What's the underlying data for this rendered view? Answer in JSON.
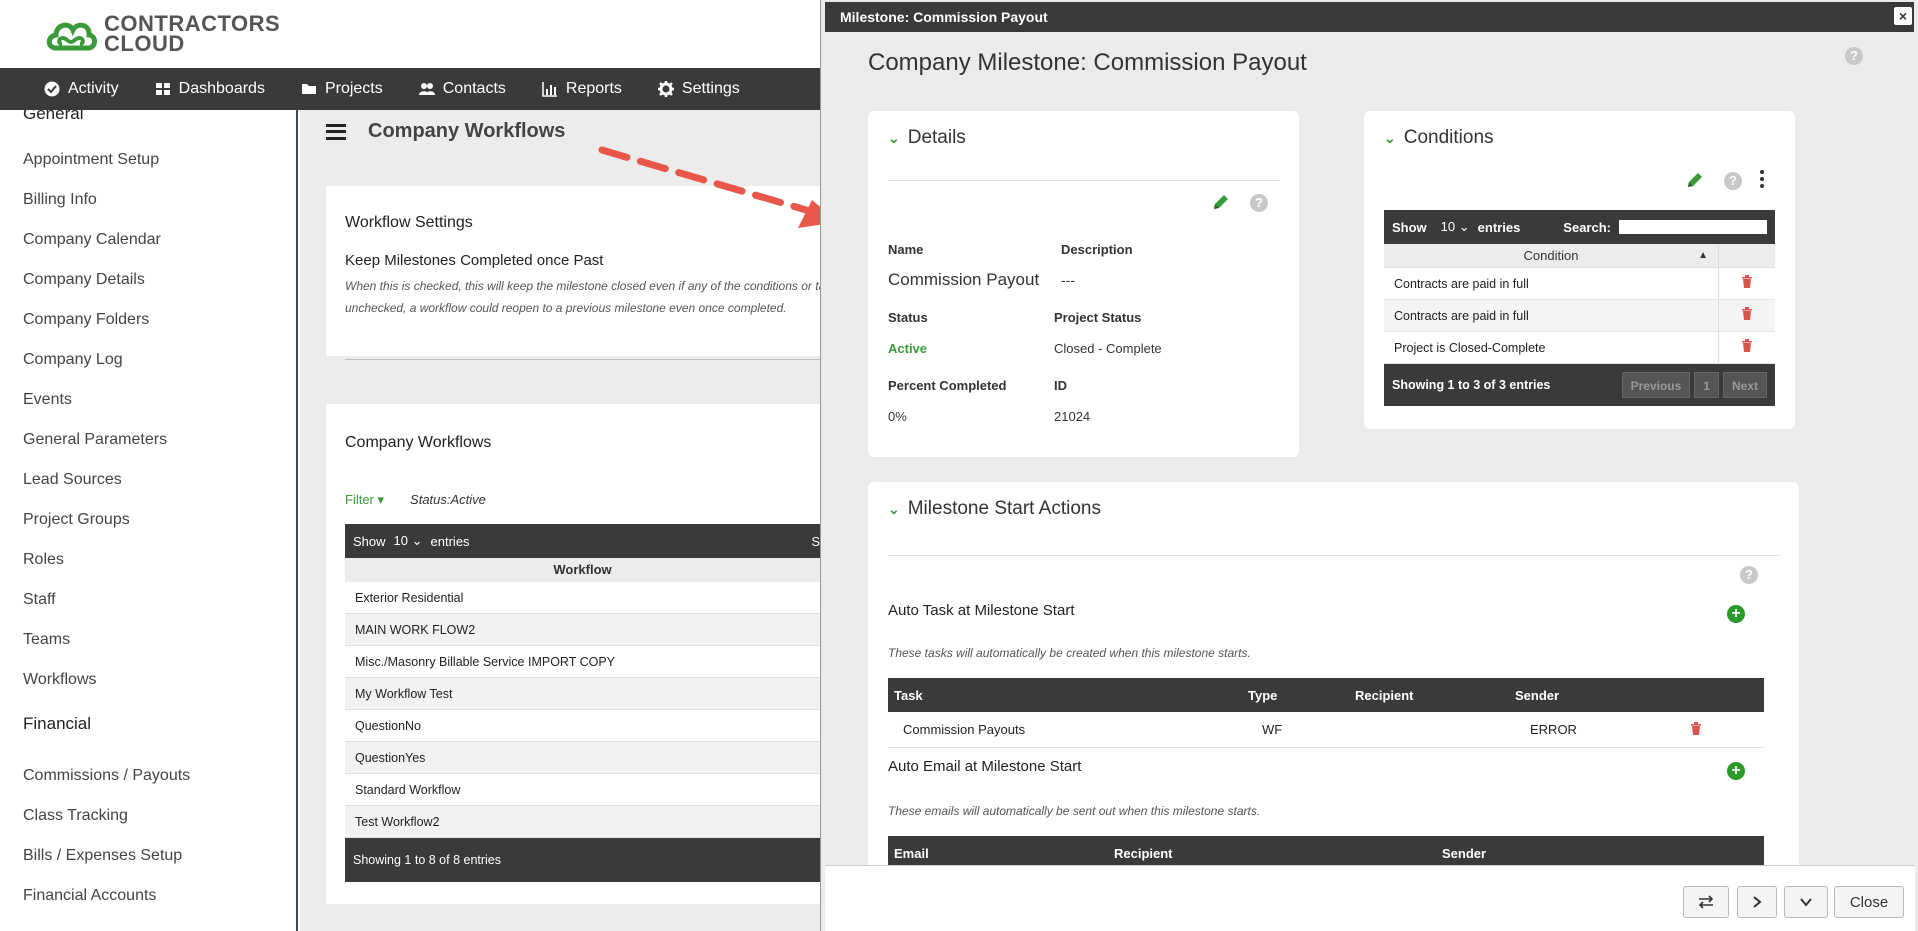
{
  "app": {
    "logo_line1": "CONTRACTORS",
    "logo_line2": "CLOUD",
    "brand_color": "#3a9a3a"
  },
  "nav": {
    "items": [
      {
        "label": "Activity",
        "icon": "check-circle-icon"
      },
      {
        "label": "Dashboards",
        "icon": "grid-icon"
      },
      {
        "label": "Projects",
        "icon": "folder-icon"
      },
      {
        "label": "Contacts",
        "icon": "users-icon"
      },
      {
        "label": "Reports",
        "icon": "bar-chart-icon"
      },
      {
        "label": "Settings",
        "icon": "gear-icon"
      }
    ]
  },
  "sidebar": {
    "general_heading": "General",
    "general_items": [
      "Appointment Setup",
      "Billing Info",
      "Company Calendar",
      "Company Details",
      "Company Folders",
      "Company Log",
      "Events",
      "General Parameters",
      "Lead Sources",
      "Project Groups",
      "Roles",
      "Staff",
      "Teams",
      "Workflows"
    ],
    "financial_heading": "Financial",
    "financial_items": [
      "Commissions / Payouts",
      "Class Tracking",
      "Bills / Expenses Setup",
      "Financial Accounts"
    ]
  },
  "main": {
    "title": "Company Workflows",
    "settings_card": {
      "heading": "Workflow Settings",
      "option_label": "Keep Milestones Completed once Past",
      "note": "When this is checked, this will keep the milestone closed even if any of the conditions or tasks are reopened. If unchecked, a workflow could reopen to a previous milestone even once completed."
    },
    "workflows_card": {
      "heading": "Company Workflows",
      "filter_label": "Filter",
      "filter_value": "Status:Active",
      "show_label": "Show",
      "show_value": "10",
      "entries_label": "entries",
      "search_stub": "S",
      "column": "Workflow",
      "rows": [
        "Exterior Residential",
        "MAIN WORK FLOW2",
        "Misc./Masonry Billable Service IMPORT COPY",
        "My Workflow Test",
        "QuestionNo",
        "QuestionYes",
        "Standard Workflow",
        "Test Workflow2"
      ],
      "footer": "Showing 1 to 8 of 8 entries"
    }
  },
  "modal": {
    "title": "Milestone: Commission Payout",
    "close_x": "×",
    "heading": "Company Milestone: Commission Payout",
    "details": {
      "title": "Details",
      "name_label": "Name",
      "name_value": "Commission Payout",
      "desc_label": "Description",
      "desc_value": "---",
      "status_label": "Status",
      "status_value": "Active",
      "project_status_label": "Project Status",
      "project_status_value": "Closed - Complete",
      "percent_label": "Percent Completed",
      "percent_value": "0%",
      "id_label": "ID",
      "id_value": "21024"
    },
    "conditions": {
      "title": "Conditions",
      "show_label": "Show",
      "show_value": "10",
      "entries_label": "entries",
      "search_label": "Search:",
      "column": "Condition",
      "rows": [
        "Contracts are paid in full",
        "Contracts are paid in full",
        "Project is Closed-Complete"
      ],
      "footer": "Showing 1 to 3 of 3 entries",
      "prev": "Previous",
      "page": "1",
      "next": "Next"
    },
    "start_actions": {
      "title": "Milestone Start Actions",
      "task_heading": "Auto Task at Milestone Start",
      "task_note": "These tasks will automatically be created when this milestone starts.",
      "task_columns": [
        "Task",
        "Type",
        "Recipient",
        "Sender"
      ],
      "task_rows": [
        {
          "task": "Commission Payouts",
          "type": "WF",
          "recipient": "",
          "sender": "ERROR"
        }
      ],
      "email_heading": "Auto Email at Milestone Start",
      "email_note": "These emails will automatically be sent out when this milestone starts.",
      "email_columns": [
        "Email",
        "Recipient",
        "Sender"
      ]
    },
    "footer": {
      "close_label": "Close"
    }
  }
}
